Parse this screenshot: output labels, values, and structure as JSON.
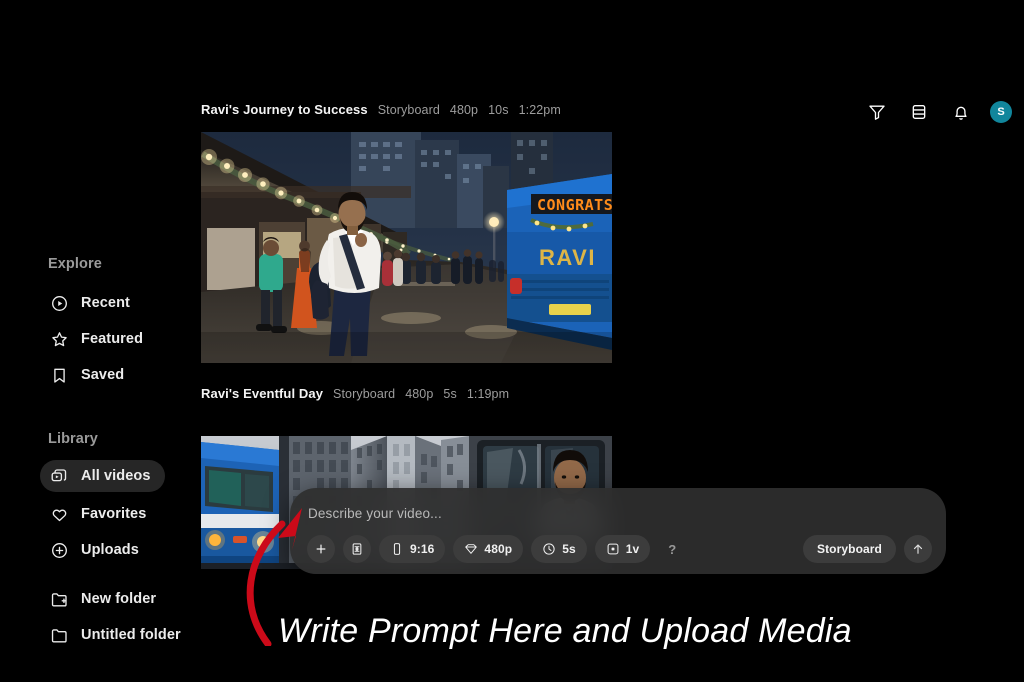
{
  "app": {
    "brand_icon": "openai-logo",
    "background": "#000000"
  },
  "sidebar": {
    "sections": [
      {
        "title": "Explore",
        "items": [
          {
            "label": "Recent",
            "icon": "play-circle-icon",
            "active": false
          },
          {
            "label": "Featured",
            "icon": "star-icon",
            "active": false
          },
          {
            "label": "Saved",
            "icon": "bookmark-icon",
            "active": false
          }
        ]
      },
      {
        "title": "Library",
        "items": [
          {
            "label": "All videos",
            "icon": "video-stack-icon",
            "active": true
          },
          {
            "label": "Favorites",
            "icon": "heart-icon",
            "active": false
          },
          {
            "label": "Uploads",
            "icon": "plus-circle-icon",
            "active": false
          },
          {
            "label": "New folder",
            "icon": "folder-plus-icon",
            "active": false
          },
          {
            "label": "Untitled folder",
            "icon": "folder-icon",
            "active": false
          }
        ]
      }
    ]
  },
  "header": {
    "actions": [
      {
        "name": "filter-icon",
        "label": "Filter"
      },
      {
        "name": "layout-toggle-icon",
        "label": "Layout"
      },
      {
        "name": "bell-icon",
        "label": "Notifications"
      }
    ],
    "avatar": {
      "initial": "S",
      "color": "#11869c"
    }
  },
  "feed": {
    "videos": [
      {
        "title": "Ravi's Journey to Success",
        "mode": "Storyboard",
        "resolution": "480p",
        "duration": "10s",
        "time": "1:22pm",
        "thumbnail_alt": "Man in white shirt walking on a lit evening street beside a blue bus showing CONGRATS and RAVI"
      },
      {
        "title": "Ravi's Eventful Day",
        "mode": "Storyboard",
        "resolution": "480p",
        "duration": "5s",
        "time": "1:19pm",
        "thumbnail_alt": "Blue bus beside tall city buildings with a bearded man seen through the bus window"
      }
    ]
  },
  "composer": {
    "placeholder": "Describe your video...",
    "pills": [
      {
        "name": "add-media-button",
        "icon": "plus-icon",
        "label": ""
      },
      {
        "name": "storyboard-button",
        "icon": "storyboard-icon",
        "label": ""
      },
      {
        "name": "aspect-ratio-button",
        "icon": "phone-icon",
        "label": "9:16"
      },
      {
        "name": "resolution-button",
        "icon": "diamond-icon",
        "label": "480p"
      },
      {
        "name": "duration-button",
        "icon": "clock-icon",
        "label": "5s"
      },
      {
        "name": "variations-button",
        "icon": "variations-icon",
        "label": "1v"
      },
      {
        "name": "help-button",
        "icon": "question-icon",
        "label": "?"
      }
    ],
    "mode_label": "Storyboard",
    "send_icon": "arrow-up-icon"
  },
  "annotation": {
    "text": "Write Prompt Here and Upload Media",
    "arrow_color": "#cc0a19",
    "text_color": "#ffffff"
  }
}
